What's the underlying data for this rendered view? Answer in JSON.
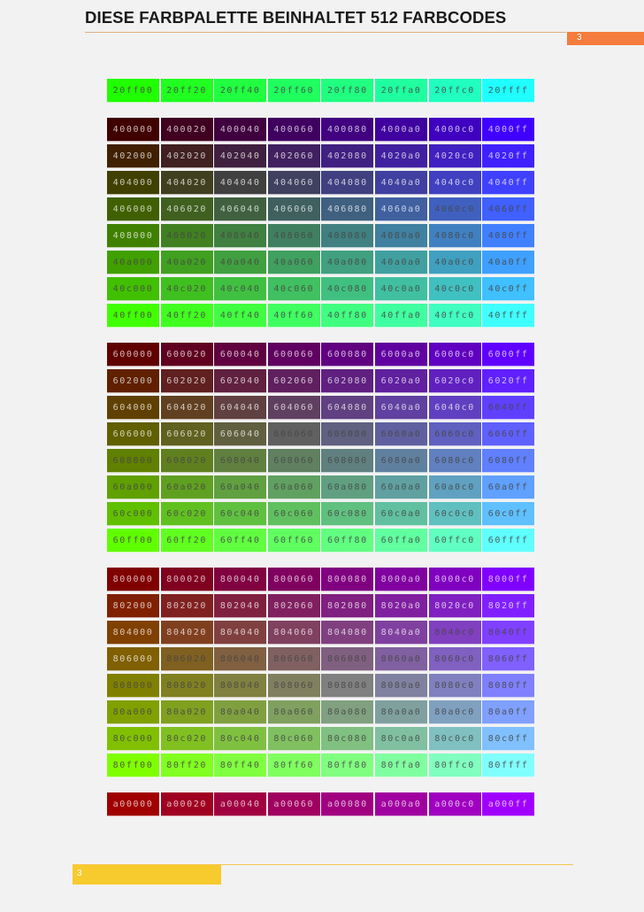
{
  "page": {
    "title": "DIESE FARBPALETTE BEINHALTET 512 FARBCODES",
    "page_number": "3",
    "footer_page_number": "3"
  },
  "palette": {
    "groups": [
      {
        "rows": [
          [
            "20ff00",
            "20ff20",
            "20ff40",
            "20ff60",
            "20ff80",
            "20ffa0",
            "20ffc0",
            "20ffff"
          ]
        ]
      },
      {
        "rows": [
          [
            "400000",
            "400020",
            "400040",
            "400060",
            "400080",
            "4000a0",
            "4000c0",
            "4000ff"
          ],
          [
            "402000",
            "402020",
            "402040",
            "402060",
            "402080",
            "4020a0",
            "4020c0",
            "4020ff"
          ],
          [
            "404000",
            "404020",
            "404040",
            "404060",
            "404080",
            "4040a0",
            "4040c0",
            "4040ff"
          ],
          [
            "406000",
            "406020",
            "406040",
            "406060",
            "406080",
            "4060a0",
            "4060c0",
            "4060ff"
          ],
          [
            "408000",
            "408020",
            "408040",
            "408060",
            "408080",
            "4080a0",
            "4080c0",
            "4080ff"
          ],
          [
            "40a000",
            "40a020",
            "40a040",
            "40a060",
            "40a080",
            "40a0a0",
            "40a0c0",
            "40a0ff"
          ],
          [
            "40c000",
            "40c020",
            "40c040",
            "40c060",
            "40c080",
            "40c0a0",
            "40c0c0",
            "40c0ff"
          ],
          [
            "40ff00",
            "40ff20",
            "40ff40",
            "40ff60",
            "40ff80",
            "40ffa0",
            "40ffc0",
            "40ffff"
          ]
        ]
      },
      {
        "rows": [
          [
            "600000",
            "600020",
            "600040",
            "600060",
            "600080",
            "6000a0",
            "6000c0",
            "6000ff"
          ],
          [
            "602000",
            "602020",
            "602040",
            "602060",
            "602080",
            "6020a0",
            "6020c0",
            "6020ff"
          ],
          [
            "604000",
            "604020",
            "604040",
            "604060",
            "604080",
            "6040a0",
            "6040c0",
            "6040ff"
          ],
          [
            "606000",
            "606020",
            "606040",
            "606060",
            "606080",
            "6060a0",
            "6060c0",
            "6060ff"
          ],
          [
            "608000",
            "608020",
            "608040",
            "608060",
            "608080",
            "6080a0",
            "6080c0",
            "6080ff"
          ],
          [
            "60a000",
            "60a020",
            "60a040",
            "60a060",
            "60a080",
            "60a0a0",
            "60a0c0",
            "60a0ff"
          ],
          [
            "60c000",
            "60c020",
            "60c040",
            "60c060",
            "60c080",
            "60c0a0",
            "60c0c0",
            "60c0ff"
          ],
          [
            "60ff00",
            "60ff20",
            "60ff40",
            "60ff60",
            "60ff80",
            "60ffa0",
            "60ffc0",
            "60ffff"
          ]
        ]
      },
      {
        "rows": [
          [
            "800000",
            "800020",
            "800040",
            "800060",
            "800080",
            "8000a0",
            "8000c0",
            "8000ff"
          ],
          [
            "802000",
            "802020",
            "802040",
            "802060",
            "802080",
            "8020a0",
            "8020c0",
            "8020ff"
          ],
          [
            "804000",
            "804020",
            "804040",
            "804060",
            "804080",
            "8040a0",
            "8040c0",
            "8040ff"
          ],
          [
            "806000",
            "806020",
            "806040",
            "806060",
            "806080",
            "8060a0",
            "8060c0",
            "8060ff"
          ],
          [
            "808000",
            "808020",
            "808040",
            "808060",
            "808080",
            "8080a0",
            "8080c0",
            "8080ff"
          ],
          [
            "80a000",
            "80a020",
            "80a040",
            "80a060",
            "80a080",
            "80a0a0",
            "80a0c0",
            "80a0ff"
          ],
          [
            "80c000",
            "80c020",
            "80c040",
            "80c060",
            "80c080",
            "80c0a0",
            "80c0c0",
            "80c0ff"
          ],
          [
            "80ff00",
            "80ff20",
            "80ff40",
            "80ff60",
            "80ff80",
            "80ffa0",
            "80ffc0",
            "80ffff"
          ]
        ]
      },
      {
        "rows": [
          [
            "a00000",
            "a00020",
            "a00040",
            "a00060",
            "a00080",
            "a000a0",
            "a000c0",
            "a000ff"
          ]
        ]
      }
    ]
  }
}
